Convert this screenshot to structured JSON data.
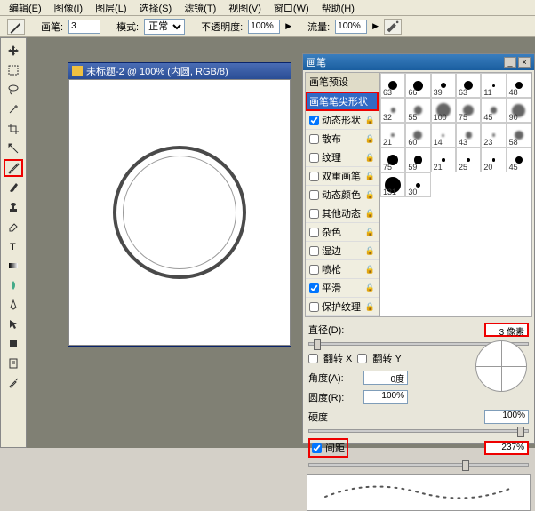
{
  "menu": [
    "编辑(E)",
    "图像(I)",
    "图层(L)",
    "选择(S)",
    "滤镜(T)",
    "视图(V)",
    "窗口(W)",
    "帮助(H)"
  ],
  "options": {
    "brush_label": "画笔:",
    "brush_size": "3",
    "mode_label": "模式:",
    "mode_value": "正常",
    "opacity_label": "不透明度:",
    "opacity_value": "100%",
    "flow_label": "流量:",
    "flow_value": "100%"
  },
  "doc": {
    "title": "未标题-2 @ 100% (内圆, RGB/8)"
  },
  "panel": {
    "title": "画笔",
    "sidemenu": {
      "presets": "画笔预设",
      "tip": "画笔笔尖形状",
      "dyn": "动态形状",
      "scatter": "散布",
      "texture": "纹理",
      "dual": "双重画笔",
      "color": "动态颜色",
      "other": "其他动态",
      "noise": "杂色",
      "wet": "湿边",
      "airbrush": "喷枪",
      "smooth": "平滑",
      "protect": "保护纹理"
    },
    "presets": [
      63,
      66,
      39,
      63,
      11,
      48,
      32,
      55,
      100,
      75,
      45,
      90,
      21,
      60,
      14,
      43,
      23,
      58,
      75,
      59,
      21,
      25,
      20,
      45,
      131,
      30
    ],
    "controls": {
      "diameter_label": "直径(D):",
      "diameter_value": "3 像素",
      "flipx": "翻转 X",
      "flipy": "翻转 Y",
      "angle_label": "角度(A):",
      "angle_value": "0度",
      "round_label": "圆度(R):",
      "round_value": "100%",
      "hardness_label": "硬度",
      "hardness_value": "100%",
      "spacing_label": "间距",
      "spacing_value": "237%"
    }
  }
}
